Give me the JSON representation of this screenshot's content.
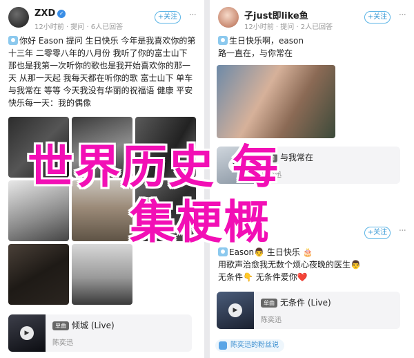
{
  "left_post": {
    "username": "ZXD",
    "meta": "12小时前 · 提问 · 6人已回答",
    "follow_label": "+关注",
    "text": "你好 Eason 提问 生日快乐 今年是我喜欢你的第十三年 二零零八年的八月份 我听了你的富士山下 那也是我第一次听你的歌也是我开始喜欢你的那一天 从那一天起 我每天都在听你的歌 富士山下 单车 与我常在 等等 今天我没有华丽的祝福语 健康 平安 快乐每一天：我的偶像",
    "music": {
      "tag": "单曲",
      "title": "倾城 (Live)",
      "artist": "陈奕迅",
      "play_icon": "play-icon"
    }
  },
  "right_post_1": {
    "username": "子just即like鱼",
    "meta": "12小时前 · 提问 · 2人已回答",
    "follow_label": "+关注",
    "line1": "生日快乐啊，eason",
    "line2": "路一直在，与你常在",
    "music": {
      "tag": "单曲",
      "title": "与我常在",
      "artist": "陈奕迅"
    }
  },
  "right_post_2": {
    "follow_label": "+关注",
    "line1": "Eason👨 生日快乐 🎂",
    "line2": "用歌声治愈我无数个烦心夜晚的医生👨",
    "line3": "无条件👇 无条件爱你❤️",
    "music": {
      "tag": "单曲",
      "title": "无条件 (Live)",
      "artist": "陈奕迅"
    },
    "fan_chip": "陈奕迅的粉丝说"
  },
  "overlay": {
    "line1": "世界历史 每",
    "line2": "集梗概"
  },
  "colors": {
    "accent": "#3a9ad6",
    "overlay": "#f20fb5"
  }
}
